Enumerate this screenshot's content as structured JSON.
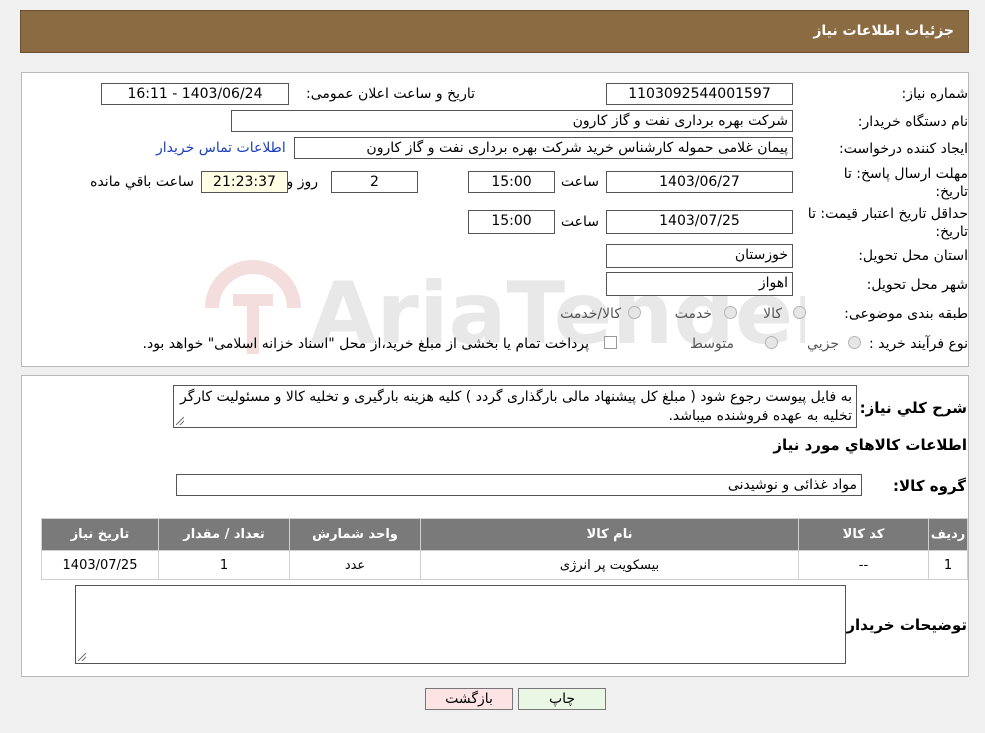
{
  "header": {
    "title": "جزئیات اطلاعات نیاز"
  },
  "details": {
    "need_number_label": "شماره نیاز:",
    "need_number": "1103092544001597",
    "announce_label": "تاریخ و ساعت اعلان عمومی:",
    "announce_value": "1403/06/24 - 16:11",
    "buyer_org_label": "نام دستگاه خریدار:",
    "buyer_org": "شرکت بهره برداری نفت و گاز کارون",
    "creator_label": "ایجاد کننده درخواست:",
    "creator": "پیمان غلامی حموله کارشناس خرید شرکت بهره برداری نفت و گاز کارون",
    "contact_link": "اطلاعات تماس خریدار",
    "deadline_label_1": "مهلت ارسال پاسخ: تا",
    "deadline_label_2": "تاریخ:",
    "deadline_date": "1403/06/27",
    "time_label": "ساعت",
    "deadline_time": "15:00",
    "days_value": "2",
    "days_label": "روز و",
    "remaining_time": "21:23:37",
    "remaining_label": "ساعت باقي مانده",
    "validity_label_1": "حداقل تاریخ اعتبار قیمت: تا",
    "validity_label_2": "تاریخ:",
    "validity_date": "1403/07/25",
    "validity_time_label": "ساعت",
    "validity_time": "15:00",
    "province_label": "استان محل تحویل:",
    "province": "خوزستان",
    "city_label": "شهر محل تحویل:",
    "city": "اهواز",
    "category_label": "طبقه بندی موضوعی:",
    "category_options": [
      "کالا",
      "خدمت",
      "کالا/خدمت"
    ],
    "process_label": "نوع فرآیند خرید :",
    "process_options": [
      "جزیي",
      "متوسط"
    ],
    "payment_note": "پرداخت تمام یا بخشی از مبلغ خرید،از محل \"اسناد خزانه اسلامی\" خواهد بود."
  },
  "summary": {
    "label": "شرح کلي نياز:",
    "text": "به فایل پیوست رجوع شود ( مبلغ کل پیشنهاد مالی بارگذاری گردد ) کلیه هزینه بارگیری و تخلیه کالا و مسئولیت کارگر تخلیه به عهده فروشنده میباشد."
  },
  "goods": {
    "section_title": "اطلاعات کالاهاي مورد نياز",
    "group_label": "گروه کالا:",
    "group_value": "مواد غذائی و نوشیدنی",
    "columns": [
      "رديف",
      "کد کالا",
      "نام کالا",
      "واحد شمارش",
      "تعداد / مقدار",
      "تاريخ نياز"
    ],
    "rows": [
      [
        "1",
        "--",
        "بیسکویت پر انرژی",
        "عدد",
        "1",
        "1403/07/25"
      ]
    ],
    "buyer_notes_label": "توضیحات خریدار:"
  },
  "buttons": {
    "print": "چاپ",
    "back": "بازگشت"
  },
  "colors": {
    "header_bg": "#8b6b42",
    "table_header_bg": "#7a7a7a",
    "back_btn_bg": "#fde4e4",
    "print_btn_bg": "#eaf7e4"
  },
  "watermark": {
    "text": "AriaTender.neT"
  }
}
